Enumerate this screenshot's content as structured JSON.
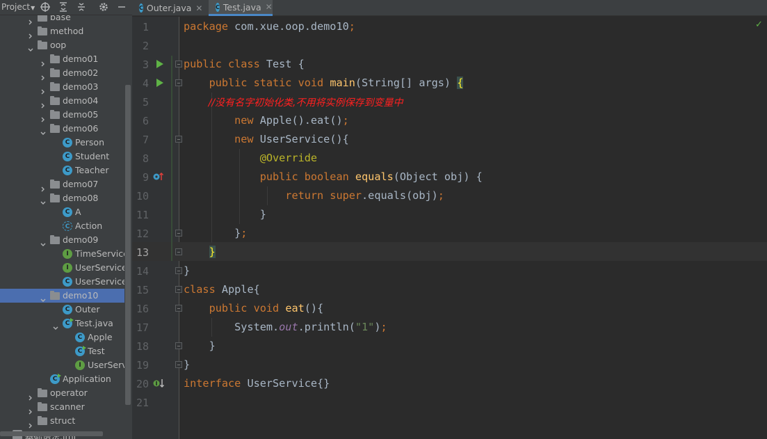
{
  "sidebar": {
    "title": "Project",
    "toolbar_icons": [
      "crosshair-icon",
      "expand-all-icon",
      "collapse-all-icon",
      "gear-icon",
      "minimize-icon"
    ],
    "tree": [
      {
        "label": "base",
        "type": "folder",
        "depth": 1,
        "expanded": false
      },
      {
        "label": "method",
        "type": "folder",
        "depth": 1,
        "expanded": false
      },
      {
        "label": "oop",
        "type": "folder",
        "depth": 1,
        "expanded": true
      },
      {
        "label": "demo01",
        "type": "folder",
        "depth": 2,
        "expanded": false
      },
      {
        "label": "demo02",
        "type": "folder",
        "depth": 2,
        "expanded": false
      },
      {
        "label": "demo03",
        "type": "folder",
        "depth": 2,
        "expanded": false
      },
      {
        "label": "demo04",
        "type": "folder",
        "depth": 2,
        "expanded": false
      },
      {
        "label": "demo05",
        "type": "folder",
        "depth": 2,
        "expanded": false
      },
      {
        "label": "demo06",
        "type": "folder",
        "depth": 2,
        "expanded": true
      },
      {
        "label": "Person",
        "type": "class",
        "depth": 3
      },
      {
        "label": "Student",
        "type": "class",
        "depth": 3
      },
      {
        "label": "Teacher",
        "type": "class",
        "depth": 3
      },
      {
        "label": "demo07",
        "type": "folder",
        "depth": 2,
        "expanded": false
      },
      {
        "label": "demo08",
        "type": "folder",
        "depth": 2,
        "expanded": true
      },
      {
        "label": "A",
        "type": "class",
        "depth": 3
      },
      {
        "label": "Action",
        "type": "abstract",
        "depth": 3
      },
      {
        "label": "demo09",
        "type": "folder",
        "depth": 2,
        "expanded": true
      },
      {
        "label": "TimeService",
        "type": "interface",
        "depth": 3
      },
      {
        "label": "UserService",
        "type": "interface",
        "depth": 3
      },
      {
        "label": "UserServiceIm",
        "type": "class",
        "depth": 3
      },
      {
        "label": "demo10",
        "type": "folder",
        "depth": 2,
        "expanded": true,
        "selected": true
      },
      {
        "label": "Outer",
        "type": "class",
        "depth": 3
      },
      {
        "label": "Test.java",
        "type": "classrun",
        "depth": 3,
        "expanded": true
      },
      {
        "label": "Apple",
        "type": "class",
        "depth": 4
      },
      {
        "label": "Test",
        "type": "classrun",
        "depth": 4
      },
      {
        "label": "UserServic",
        "type": "interface",
        "depth": 4
      },
      {
        "label": "Application",
        "type": "classrun",
        "depth": 2
      },
      {
        "label": "operator",
        "type": "folder",
        "depth": 1,
        "expanded": false
      },
      {
        "label": "scanner",
        "type": "folder",
        "depth": 1,
        "expanded": false
      },
      {
        "label": "struct",
        "type": "folder",
        "depth": 1,
        "expanded": false
      },
      {
        "label": "基础语法.iml",
        "type": "file",
        "depth": 0
      }
    ]
  },
  "tabs": [
    {
      "label": "Outer.java",
      "active": false
    },
    {
      "label": "Test.java",
      "active": true
    }
  ],
  "editor": {
    "current_line": 13,
    "line_numbers": [
      "1",
      "2",
      "3",
      "4",
      "5",
      "6",
      "7",
      "8",
      "9",
      "10",
      "11",
      "12",
      "13",
      "14",
      "15",
      "16",
      "17",
      "18",
      "19",
      "20",
      "21"
    ],
    "lines": {
      "l1a": "package ",
      "l1b": "com.xue.oop.demo10",
      "l1c": ";",
      "l3a": "public class ",
      "l3b": "Test {",
      "l4a": "    public static void ",
      "l4b": "main",
      "l4c": "(String[] args) ",
      "l4d": "{",
      "l5": "        //没有名字初始化类,不用将实例保存到变量中",
      "l6a": "        new ",
      "l6b": "Apple().eat()",
      "l6c": ";",
      "l7a": "        new ",
      "l7b": "UserService(){",
      "l8": "            @Override",
      "l9a": "            public boolean ",
      "l9b": "equals",
      "l9c": "(Object obj) {",
      "l10a": "                return super",
      "l10b": ".equals(obj)",
      "l10c": ";",
      "l11": "            }",
      "l12a": "        }",
      "l12b": ";",
      "l13a": "    ",
      "l13b": "}",
      "l14": "}",
      "l15a": "class ",
      "l15b": "Apple{",
      "l16a": "    public void ",
      "l16b": "eat",
      "l16c": "(){",
      "l17a": "        System.",
      "l17b": "out",
      "l17c": ".println(",
      "l17d": "\"1\"",
      "l17e": ")",
      "l17f": ";",
      "l18": "    }",
      "l19": "}",
      "l20a": "interface ",
      "l20b": "UserService{}"
    }
  },
  "colors": {
    "keyword": "#cc7832",
    "function": "#ffc66d",
    "string": "#6a8759",
    "annotation": "#bbb529",
    "comment": "#ff2020",
    "selection": "#4b6eaf"
  }
}
